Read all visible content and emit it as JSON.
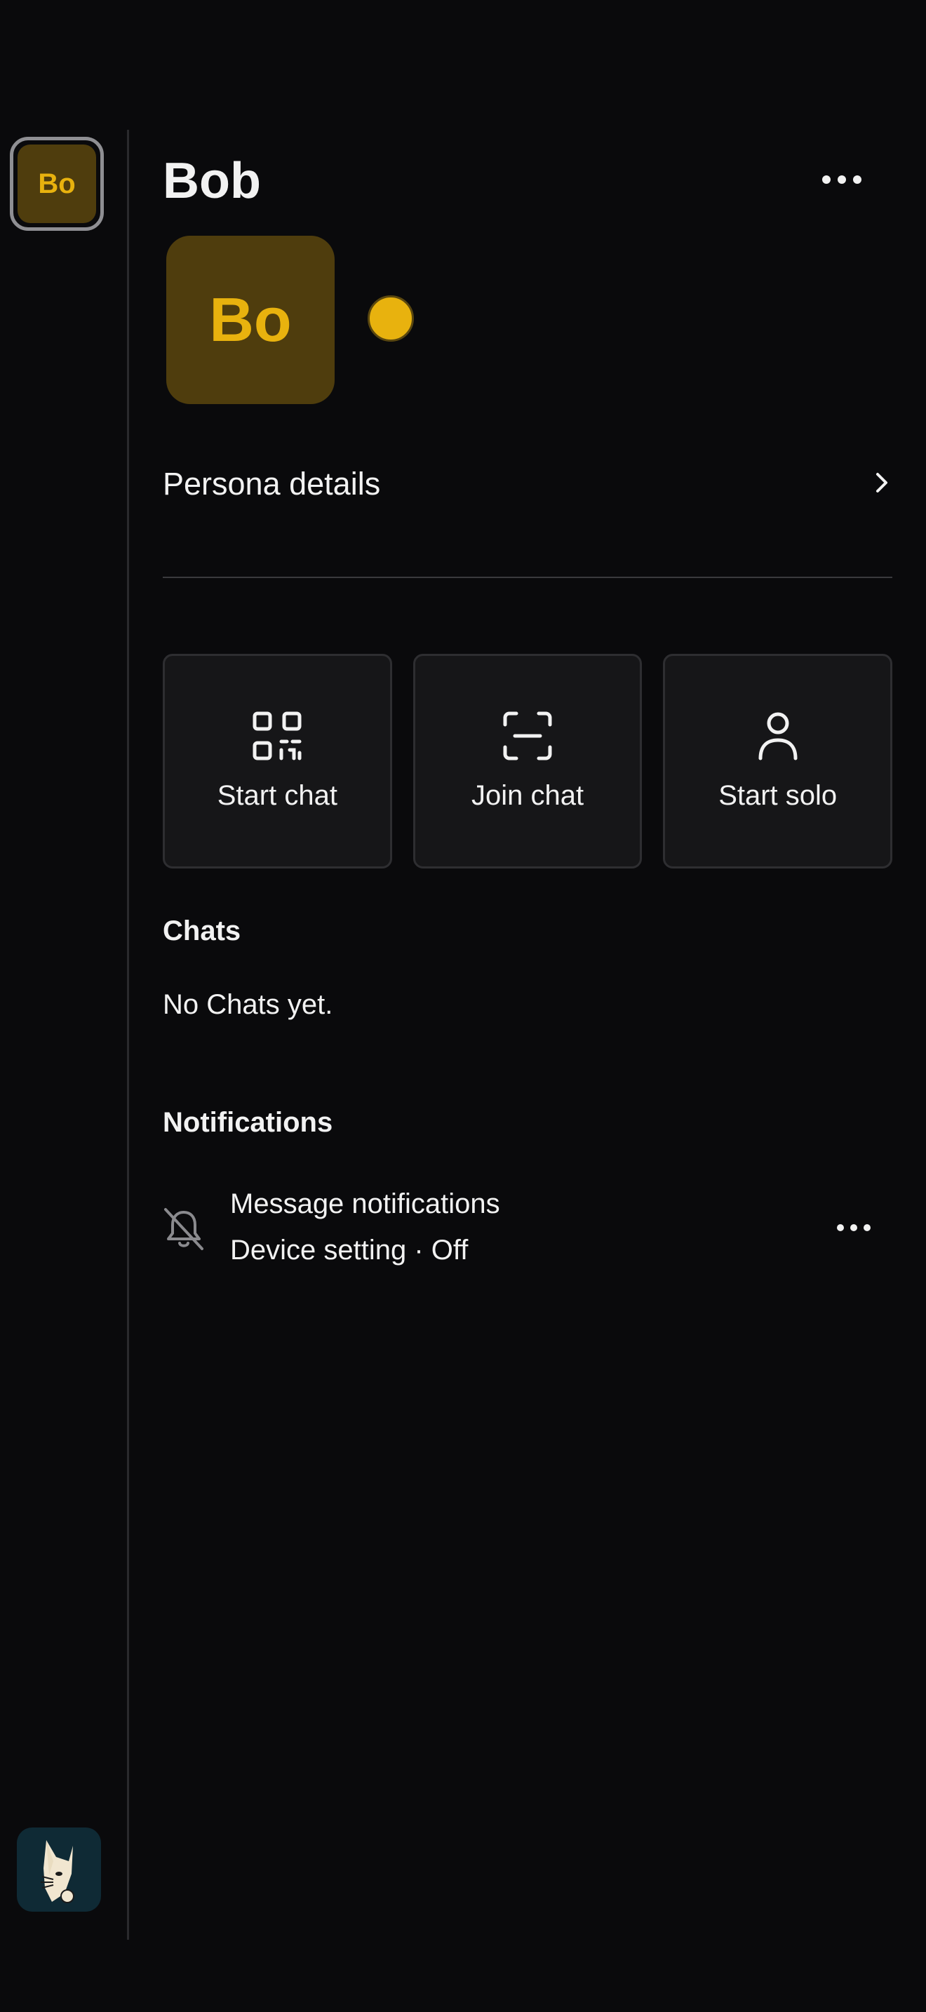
{
  "rail": {
    "avatar_initials": "Bo"
  },
  "header": {
    "title": "Bob"
  },
  "profile": {
    "avatar_initials": "Bo",
    "status_color": "#e8b20e"
  },
  "persona_details": {
    "label": "Persona details"
  },
  "actions": [
    {
      "label": "Start chat",
      "icon": "qr-code-icon"
    },
    {
      "label": "Join chat",
      "icon": "scan-icon"
    },
    {
      "label": "Start solo",
      "icon": "person-icon"
    }
  ],
  "chats": {
    "heading": "Chats",
    "empty_text": "No Chats yet."
  },
  "notifications": {
    "heading": "Notifications",
    "item": {
      "title": "Message notifications",
      "subtitle": "Device setting · Off",
      "icon": "bell-off-icon"
    }
  },
  "colors": {
    "background": "#0a0a0c",
    "accent": "#e8b20e",
    "avatar_bg": "#4f3d0d",
    "card_bg": "#161618"
  }
}
